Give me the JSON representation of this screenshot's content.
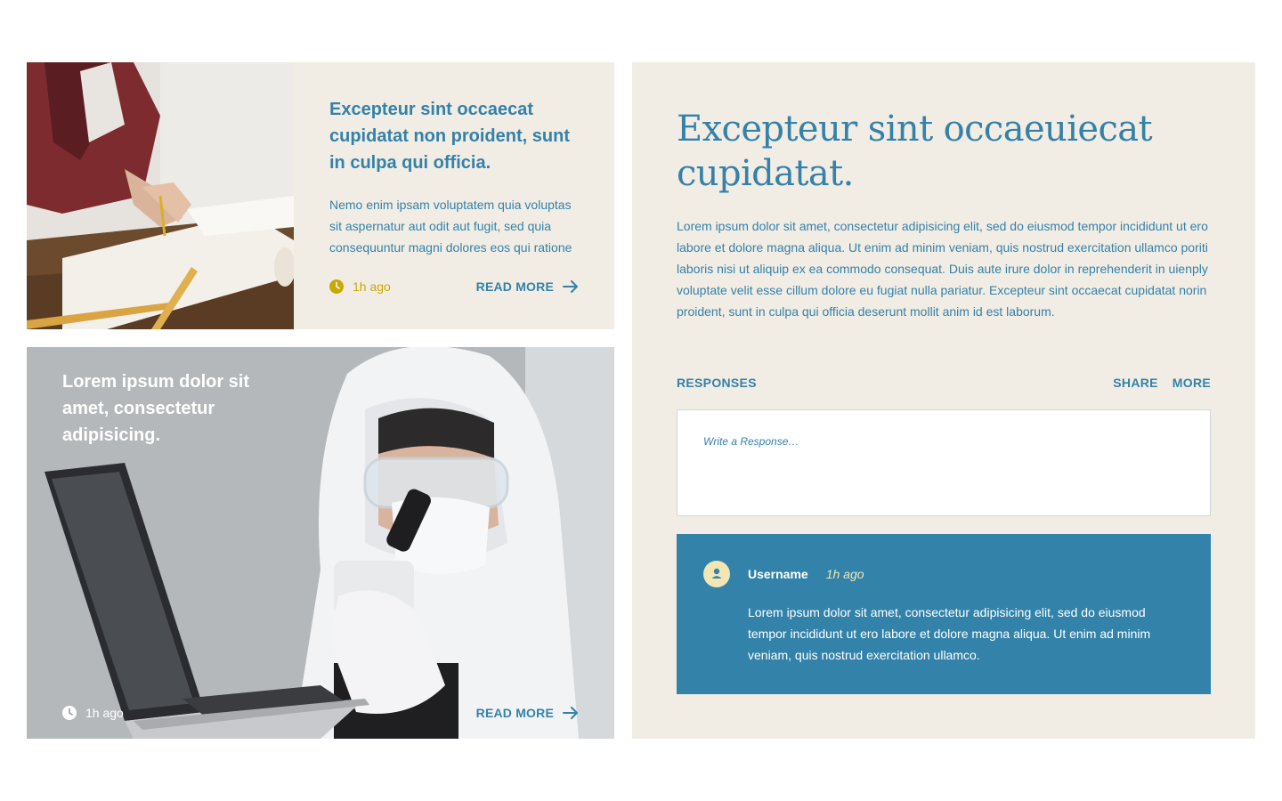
{
  "card_featured": {
    "title": "Excepteur sint occaecat cupidatat non proident, sunt in culpa qui officia.",
    "excerpt": "Nemo enim ipsam voluptatem quia voluptas sit aspernatur aut odit aut fugit, sed quia consequuntur magni dolores eos qui ratione",
    "time": "1h ago",
    "read_more": "READ MORE",
    "icons": {
      "time": "clock-icon",
      "read_more": "arrow-right-icon"
    },
    "colors": {
      "background": "#f1ede4",
      "title": "#3481aa",
      "time": "#c9a800"
    }
  },
  "card_image": {
    "title": "Lorem ipsum dolor sit amet, consectetur adipisicing.",
    "time": "1h ago",
    "read_more": "READ MORE",
    "icons": {
      "time": "clock-icon",
      "read_more": "arrow-right-icon"
    }
  },
  "article": {
    "title": "Excepteur sint occaeuiecat cupidatat.",
    "body": "Lorem ipsum dolor sit amet, consectetur adipisicing elit, sed do eiusmod tempor incididunt ut ero labore et dolore magna aliqua. Ut enim ad minim veniam, quis nostrud exercitation ullamco poriti laboris nisi ut aliquip ex ea commodo consequat. Duis aute irure dolor in reprehenderit in uienply voluptate velit esse cillum dolore eu fugiat nulla pariatur. Excepteur sint occaecat cupidatat norin proident, sunt in culpa qui officia deserunt mollit anim id est laborum.",
    "responses_label": "RESPONSES",
    "actions": {
      "share": "SHARE",
      "more": "MORE"
    },
    "response_placeholder": "Write a Response…",
    "colors": {
      "background": "#f1ede4",
      "accent": "#3481aa"
    }
  },
  "comment": {
    "username": "Username",
    "time": "1h ago",
    "text": "Lorem ipsum dolor sit amet, consectetur adipisicing elit, sed do eiusmod tempor incididunt ut ero labore et dolore magna aliqua. Ut enim ad minim veniam, quis nostrud exercitation ullamco.",
    "avatar_icon": "user-icon",
    "colors": {
      "background": "#3282a9",
      "avatar": "#f3e6b4",
      "time": "#f3e6b4"
    }
  }
}
